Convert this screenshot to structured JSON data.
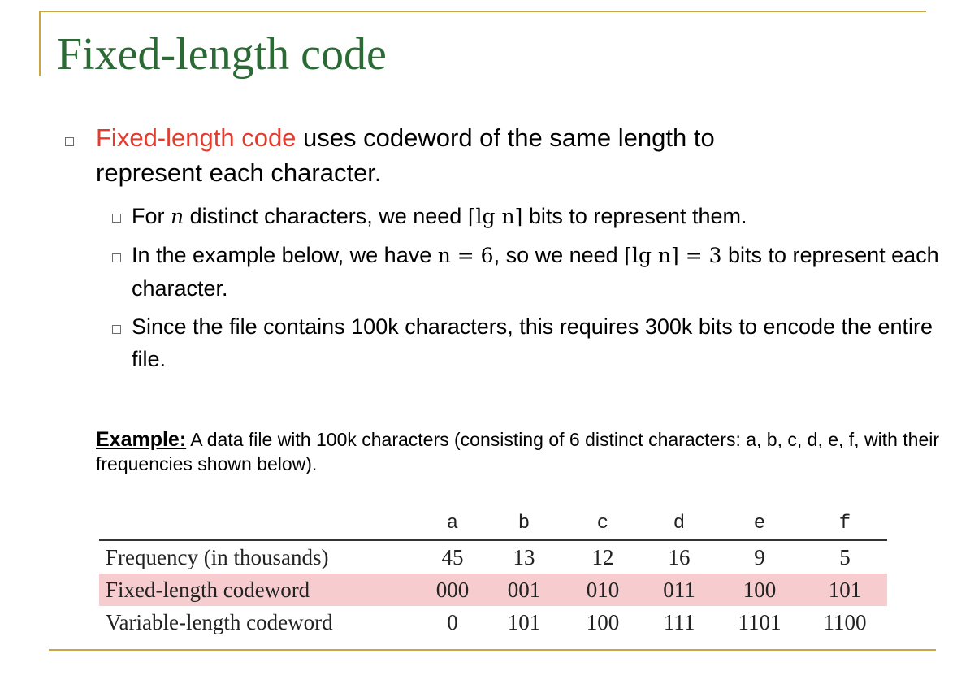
{
  "title": "Fixed-length code",
  "main_bullet": {
    "highlight": "Fixed-length code",
    "rest_line1": " uses codeword of the same length to",
    "rest_line2": "represent each character."
  },
  "sub_bullets": {
    "b1": {
      "pre": "For ",
      "var_n": "n",
      "mid": " distinct characters, we need ",
      "formula": "⌈lg n⌉",
      "post": " bits to represent them."
    },
    "b2": {
      "pre": "In the example below, we have ",
      "eq1": "n = 6",
      "mid": ", so we need ",
      "eq2": "⌈lg n⌉ = 3",
      "post": " bits to represent each character."
    },
    "b3": {
      "text": "Since the file contains 100k characters, this requires 300k bits to encode the entire file."
    }
  },
  "example": {
    "label": "Example:",
    "text": " A data file with 100k characters (consisting of 6 distinct characters: a, b, c, d, e, f, with their frequencies shown below)."
  },
  "table": {
    "columns": [
      "a",
      "b",
      "c",
      "d",
      "e",
      "f"
    ],
    "rows": [
      {
        "label": "Frequency (in thousands)",
        "values": [
          "45",
          "13",
          "12",
          "16",
          "9",
          "5"
        ]
      },
      {
        "label": "Fixed-length codeword",
        "values": [
          "000",
          "001",
          "010",
          "011",
          "100",
          "101"
        ]
      },
      {
        "label": "Variable-length codeword",
        "values": [
          "0",
          "101",
          "100",
          "111",
          "1101",
          "1100"
        ]
      }
    ]
  },
  "colors": {
    "title": "#2b6a34",
    "accent_red": "#e33b2e",
    "rule_gold": "#c9a640",
    "highlight_row": "#f6cccf"
  }
}
